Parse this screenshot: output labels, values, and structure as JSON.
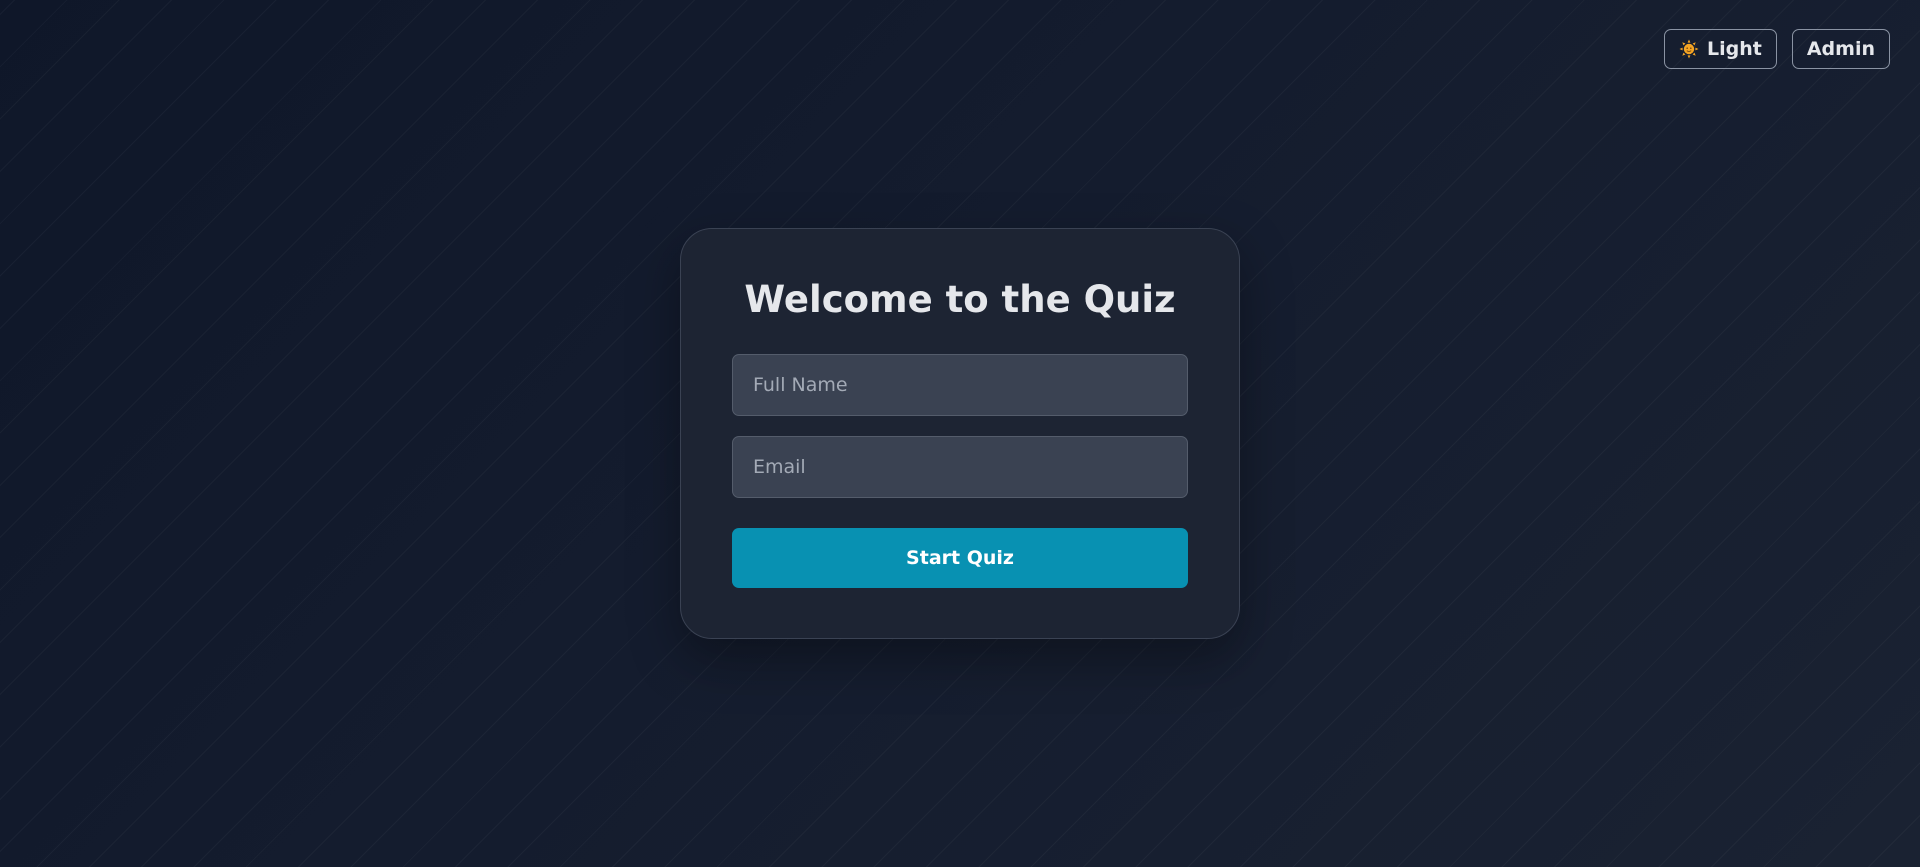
{
  "header": {
    "theme_toggle_label": "Light",
    "theme_toggle_icon": "sun-icon",
    "admin_label": "Admin"
  },
  "form": {
    "title": "Welcome to the Quiz",
    "name_placeholder": "Full Name",
    "name_value": "",
    "email_placeholder": "Email",
    "email_value": "",
    "submit_label": "Start Quiz"
  },
  "colors": {
    "background": "#0f1729",
    "card": "#1d2433",
    "input": "#3a4252",
    "accent": "#0891b2",
    "sun": "#f5a524"
  }
}
